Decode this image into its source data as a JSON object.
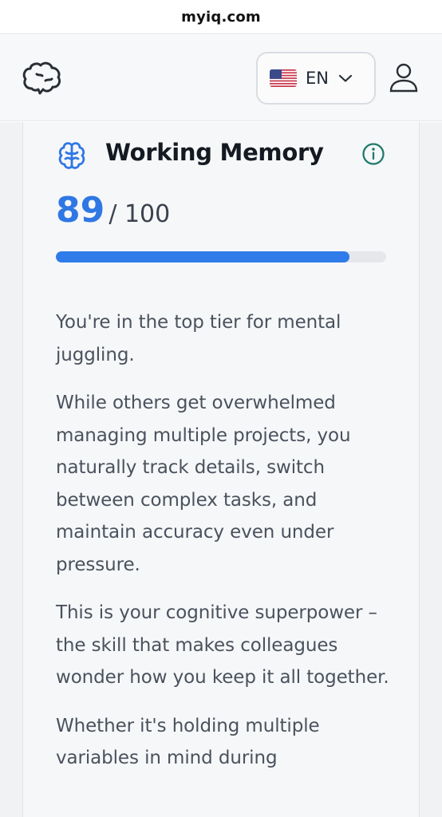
{
  "browser": {
    "url": "myiq.com"
  },
  "header": {
    "logo_icon": "brain-outline-icon",
    "language": {
      "code": "EN",
      "flag_icon": "us-flag-icon",
      "chevron_icon": "chevron-down-icon"
    },
    "user_icon": "user-account-icon"
  },
  "card": {
    "icon": "brain-icon",
    "title": "Working Memory",
    "info_icon": "info-icon",
    "score": {
      "value": "89",
      "max_label": "/ 100",
      "percent": 89
    },
    "colors": {
      "accent": "#2f77e4",
      "info": "#1f7a6b"
    },
    "paragraphs": [
      "You're in the top tier for mental juggling.",
      "While others get overwhelmed managing multiple projects, you naturally track details, switch between complex tasks, and maintain accuracy even under pressure.",
      "This is your cognitive superpower – the skill that makes colleagues wonder how you keep it all together.",
      "Whether it's holding multiple variables in mind during"
    ]
  }
}
